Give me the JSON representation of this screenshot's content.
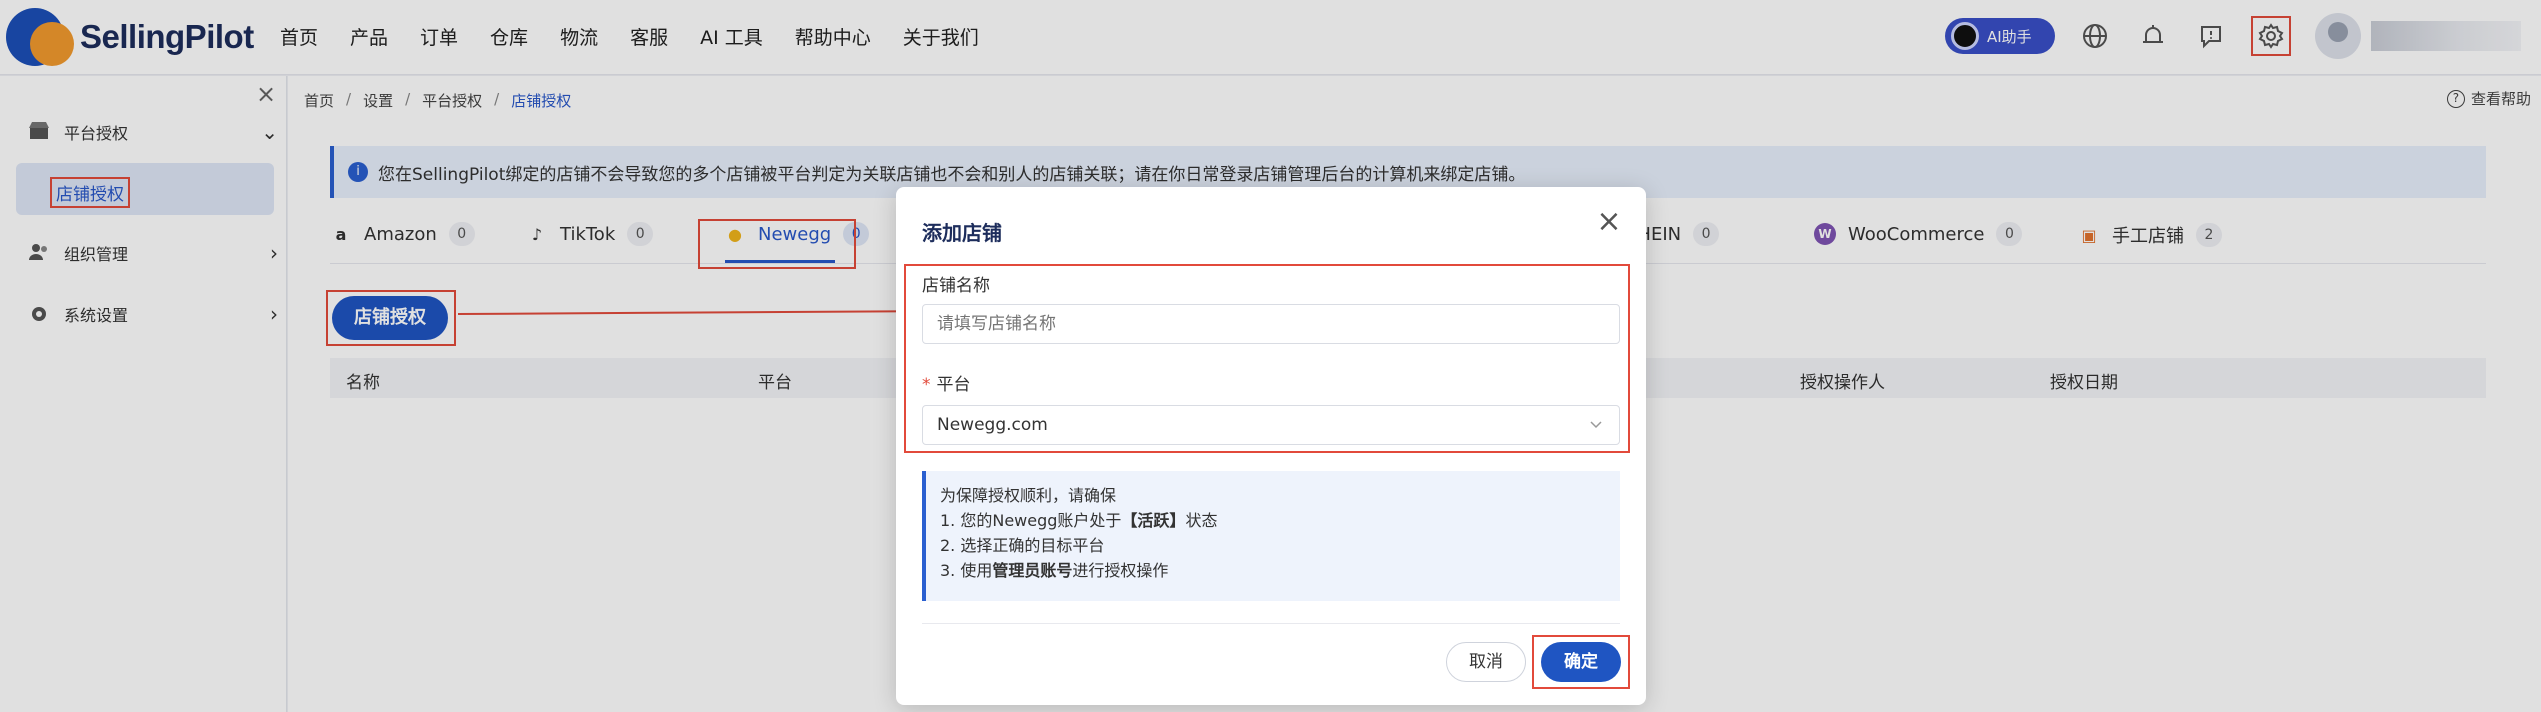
{
  "brand": {
    "name": "SellingPilot"
  },
  "nav": [
    "首页",
    "产品",
    "订单",
    "仓库",
    "物流",
    "客服",
    "AI 工具",
    "帮助中心",
    "关于我们"
  ],
  "top_right": {
    "ai_label": "AI助手"
  },
  "sidebar": {
    "close": "×",
    "groups": [
      {
        "label": "平台授权",
        "chevron": "⌄"
      },
      {
        "label": "组织管理",
        "chevron": "›"
      },
      {
        "label": "系统设置",
        "chevron": "›"
      }
    ],
    "active_sub": "店铺授权"
  },
  "breadcrumb": [
    "首页",
    "设置",
    "平台授权",
    "店铺授权"
  ],
  "breadcrumb_sep": "/",
  "help": "查看帮助",
  "notice": "您在SellingPilot绑定的店铺不会导致您的多个店铺被平台判定为关联店铺也不会和别人的店铺关联；请在你日常登录店铺管理后台的计算机来绑定店铺。",
  "tabs": [
    {
      "label": "Amazon",
      "count": "0",
      "icon": "a"
    },
    {
      "label": "TikTok",
      "count": "0",
      "icon": "♪"
    },
    {
      "label": "Newegg",
      "count": "0",
      "icon": "●",
      "active": true
    },
    {
      "label": "SHEIN",
      "count": "0",
      "icon": "S"
    },
    {
      "label": "WooCommerce",
      "count": "0",
      "icon": "W"
    },
    {
      "label": "手工店铺",
      "count": "2",
      "icon": "▣"
    }
  ],
  "auth_button": "店铺授权",
  "table_headers": [
    "名称",
    "平台",
    "授权操作人",
    "授权日期"
  ],
  "modal": {
    "title": "添加店铺",
    "close": "×",
    "store_name_label": "店铺名称",
    "store_name_placeholder": "请填写店铺名称",
    "platform_required": "*",
    "platform_label": "平台",
    "platform_value": "Newegg.com",
    "tip_title": "为保障授权顺利，请确保",
    "tips": [
      {
        "pre": "1.  您的Newegg账户处于",
        "bold": "【活跃】",
        "post": "状态"
      },
      {
        "pre": "2. 选择正确的目标平台",
        "bold": "",
        "post": ""
      },
      {
        "pre": "3. 使用",
        "bold": "管理员账号",
        "post": "进行授权操作"
      }
    ],
    "cancel": "取消",
    "confirm": "确定"
  }
}
